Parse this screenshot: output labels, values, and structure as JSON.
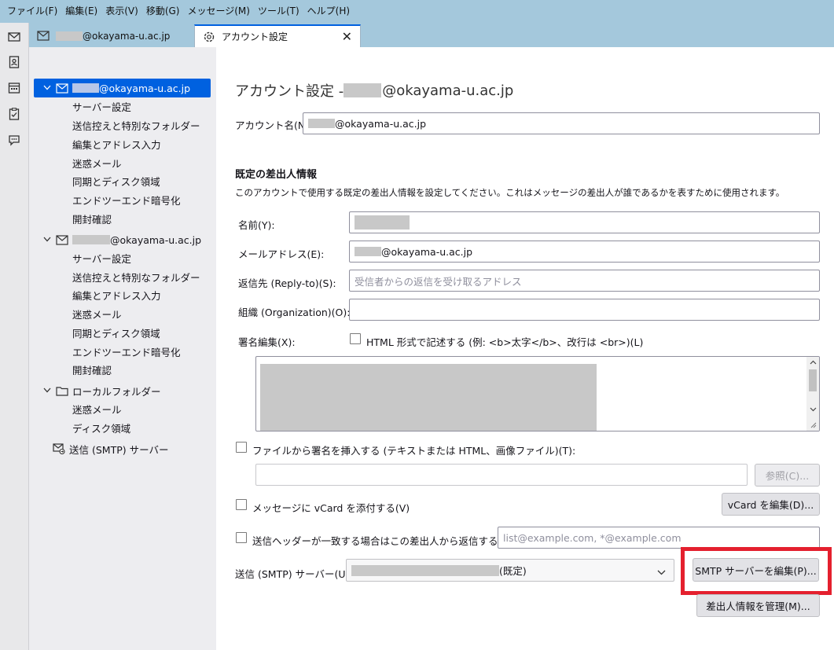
{
  "menu": [
    "ファイル(F)",
    "編集(E)",
    "表示(V)",
    "移動(G)",
    "メッセージ(M)",
    "ツール(T)",
    "ヘルプ(H)"
  ],
  "tabs": {
    "inbox_label": "@okayama-u.ac.jp",
    "settings_label": "アカウント設定",
    "close_glyph": "✕"
  },
  "tree": {
    "account1": {
      "label": "@okayama-u.ac.jp",
      "children": [
        "サーバー設定",
        "送信控えと特別なフォルダー",
        "編集とアドレス入力",
        "迷惑メール",
        "同期とディスク領域",
        "エンドツーエンド暗号化",
        "開封確認"
      ]
    },
    "account2": {
      "label": "@okayama-u.ac.jp",
      "children": [
        "サーバー設定",
        "送信控えと特別なフォルダー",
        "編集とアドレス入力",
        "迷惑メール",
        "同期とディスク領域",
        "エンドツーエンド暗号化",
        "開封確認"
      ]
    },
    "local": {
      "label": "ローカルフォルダー",
      "children": [
        "迷惑メール",
        "ディスク領域"
      ]
    },
    "smtp": {
      "label": "送信 (SMTP) サーバー"
    }
  },
  "main": {
    "title_prefix": "アカウント設定 - ",
    "title_domain": "@okayama-u.ac.jp",
    "account_name_label": "アカウント名(N):",
    "account_name_value": "@okayama-u.ac.jp",
    "identity_section_title": "既定の差出人情報",
    "identity_description": "このアカウントで使用する既定の差出人情報を設定してください。これはメッセージの差出人が誰であるかを表すために使用されます。",
    "name_label": "名前(Y):",
    "email_label": "メールアドレス(E):",
    "email_value": "@okayama-u.ac.jp",
    "replyto_label": "返信先 (Reply-to)(S):",
    "replyto_placeholder": "受信者からの返信を受け取るアドレス",
    "org_label": "組織 (Organization)(O):",
    "sig_label": "署名編集(X):",
    "html_sig_label": "HTML 形式で記述する (例: <b>太字</b>、改行は <br>)(L)",
    "sig_file_label": "ファイルから署名を挿入する (テキストまたは HTML、画像ファイル)(T):",
    "browse_button": "参照(C)...",
    "vcard_attach_label": "メッセージに vCard を添付する(V)",
    "vcard_edit_button": "vCard を編集(D)...",
    "reply_header_label": "送信ヘッダーが一致する場合はこの差出人から返信する(D):",
    "reply_header_placeholder": "list@example.com, *@example.com",
    "smtp_label": "送信 (SMTP) サーバー(U):",
    "smtp_value_suffix": "(既定)",
    "smtp_edit_button": "SMTP サーバーを編集(P)...",
    "manage_identities_button": "差出人情報を管理(M)..."
  },
  "colors": {
    "menubar": "#a4c8dc",
    "selection": "#0061e0",
    "highlight": "#e4202e"
  }
}
